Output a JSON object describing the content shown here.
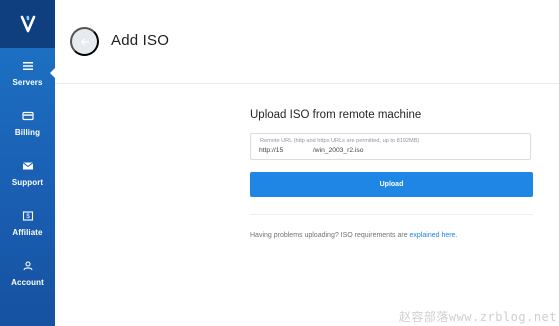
{
  "sidebar": {
    "brand": {
      "icon": "vultr-v-logo-icon"
    },
    "items": [
      {
        "label": "Servers",
        "icon": "servers-list-icon",
        "active": true
      },
      {
        "label": "Billing",
        "icon": "billing-card-icon",
        "active": false
      },
      {
        "label": "Support",
        "icon": "support-envelope-icon",
        "active": false
      },
      {
        "label": "Affiliate",
        "icon": "affiliate-dollar-icon",
        "active": false
      },
      {
        "label": "Account",
        "icon": "account-user-icon",
        "active": false
      }
    ]
  },
  "header": {
    "title": "Add ISO",
    "back_icon": "arrow-left-icon"
  },
  "upload_form": {
    "heading": "Upload ISO from remote machine",
    "url_field": {
      "label": "Remote URL (http and https URLs are permitted, up to 8192MB)",
      "value": "http://15                /win_2003_r2.iso"
    },
    "upload_button_label": "Upload"
  },
  "help": {
    "prefix": "Having problems uploading? ISO requirements are ",
    "link_text": "explained here."
  },
  "watermark": {
    "text": "赵容部落www.zrblog.net"
  },
  "colors": {
    "sidebar_blue": "#1a60b4",
    "brand_navy": "#0f3f7f",
    "primary_button": "#1f86e6",
    "link": "#1f86e6"
  }
}
